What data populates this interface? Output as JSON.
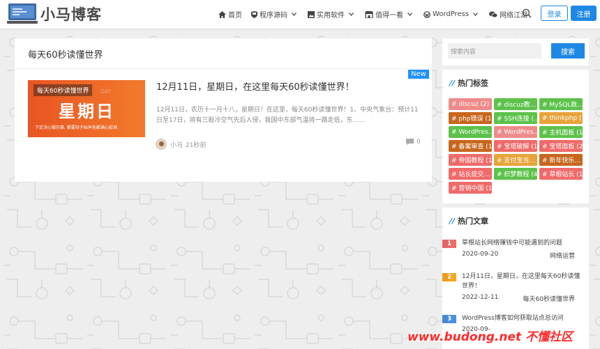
{
  "header": {
    "logo_text": "小马博客",
    "nav": [
      {
        "icon": "home-icon",
        "label": "首页",
        "has_caret": false
      },
      {
        "icon": "shield-icon",
        "label": "程序源码",
        "has_caret": true
      },
      {
        "icon": "image-icon",
        "label": "实用软件",
        "has_caret": true
      },
      {
        "icon": "store-icon",
        "label": "值得一看",
        "has_caret": true
      },
      {
        "icon": "wordpress-icon",
        "label": "WordPress",
        "has_caret": true
      },
      {
        "icon": "chat-icon",
        "label": "网络江湖",
        "has_caret": false
      }
    ],
    "login_label": "登录",
    "register_label": "注册"
  },
  "main": {
    "category_title": "每天60秒读懂世界",
    "post": {
      "badge": "New",
      "thumb_tag": "每天60秒读懂世界",
      "thumb_big": "星期日",
      "thumb_ghost": "DAY",
      "thumb_small": "下定决心做的事, 都要持于始声色都满心彭湃.",
      "title": "12月11日，星期日，在这里每天60秒读懂世界！",
      "excerpt": "12月11日，农历十一月十八，星期日！在这里，每天60秒读懂世界！1、中央气象台：预计11日至17日，将有三股冷空气先后入侵，我国中东部气温将一路走低，东……",
      "author": "小马",
      "time": "21秒前",
      "comments": "0"
    }
  },
  "sidebar": {
    "search_placeholder": "搜索内容",
    "search_button": "搜索",
    "tags_title": "热门标签",
    "tags": [
      {
        "label": "# discuz (2)",
        "color": "#f08a8a"
      },
      {
        "label": "# discuz教…",
        "color": "#5cc24a"
      },
      {
        "label": "# MySQL数…",
        "color": "#5cc24a"
      },
      {
        "label": "# php错误 (1)",
        "color": "#c7661d"
      },
      {
        "label": "# SSH连接 (…",
        "color": "#5cc24a"
      },
      {
        "label": "# thinkphp (1)",
        "color": "#e8a33a"
      },
      {
        "label": "# WordPres…",
        "color": "#5cc24a"
      },
      {
        "label": "# WordPres…",
        "color": "#f08a8a"
      },
      {
        "label": "# 主机面板 (1)",
        "color": "#5cc24a"
      },
      {
        "label": "# 备案审查 (1)",
        "color": "#c7661d"
      },
      {
        "label": "# 宝塔破解 (1)",
        "color": "#f06a6a"
      },
      {
        "label": "# 宝塔面板 (2)",
        "color": "#f06a6a"
      },
      {
        "label": "# 帝国教程 (1)",
        "color": "#f06a6a"
      },
      {
        "label": "# 支付宝当…",
        "color": "#e8a33a"
      },
      {
        "label": "# 新年快乐…",
        "color": "#c7661d"
      },
      {
        "label": "# 站长提交…",
        "color": "#f06a6a"
      },
      {
        "label": "# 织梦教程 (4)",
        "color": "#5cc24a"
      },
      {
        "label": "# 草根站长 (1)",
        "color": "#f06a6a"
      },
      {
        "label": "# 营销中国 (1)",
        "color": "#f06a6a"
      }
    ],
    "hot_title": "热门文章",
    "hot_posts": [
      {
        "num": "1",
        "color": "#f06a6a",
        "title": "草根站长网络赚钱中可能遇到的问题",
        "date": "2020-09-20",
        "category": "网络运营"
      },
      {
        "num": "2",
        "color": "#f5a623",
        "title": "12月11日，星期日，在这里每天60秒读懂世界！",
        "date": "2022-12-11",
        "category": "每天60秒读懂世界"
      },
      {
        "num": "3",
        "color": "#4a90e2",
        "title": "WordPress博客如何获取站点总访问",
        "date": "2020-09-",
        "category": ""
      }
    ]
  },
  "watermark": "www.budong.net 不懂社区"
}
